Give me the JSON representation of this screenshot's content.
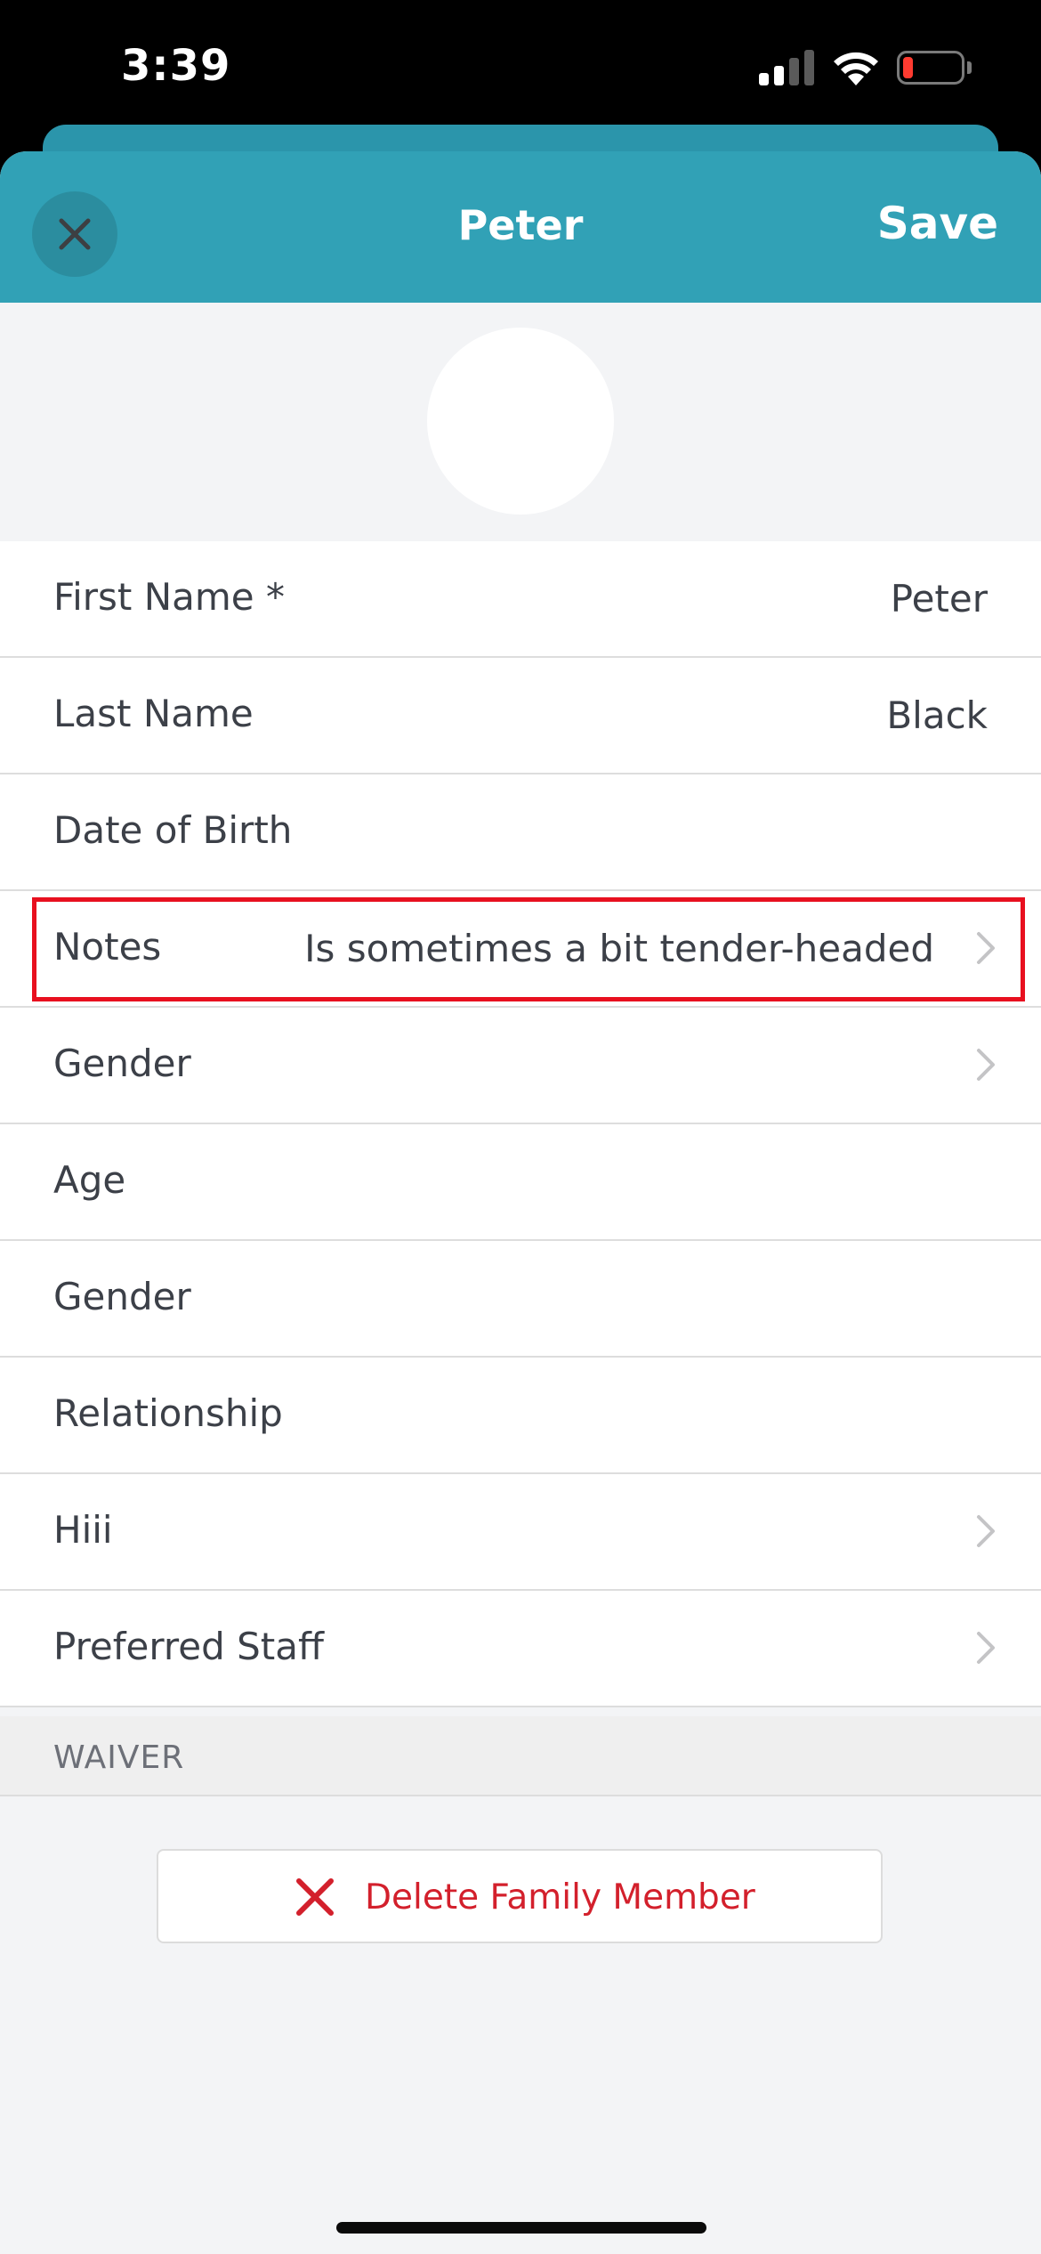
{
  "status_bar": {
    "time": "3:39",
    "icons": [
      "cellular-signal-icon",
      "wifi-icon",
      "battery-low-icon"
    ],
    "battery_level": 0.15,
    "battery_color": "#ff3b30"
  },
  "header": {
    "title": "Peter",
    "save_label": "Save",
    "close_icon": "close-icon",
    "background_color": "#31a1b6"
  },
  "form": {
    "rows": [
      {
        "label": "First Name *",
        "value": "Peter",
        "has_chevron": false
      },
      {
        "label": "Last Name",
        "value": "Black",
        "has_chevron": false
      },
      {
        "label": "Date of Birth",
        "value": "",
        "has_chevron": false
      },
      {
        "label": "Notes",
        "value": "Is sometimes a bit tender-headed",
        "has_chevron": true,
        "highlighted": true
      },
      {
        "label": "Gender",
        "value": "",
        "has_chevron": true
      },
      {
        "label": "Age",
        "value": "",
        "has_chevron": false
      },
      {
        "label": "Gender",
        "value": "",
        "has_chevron": false
      },
      {
        "label": "Relationship",
        "value": "",
        "has_chevron": false
      },
      {
        "label": "Hiii",
        "value": "",
        "has_chevron": true
      },
      {
        "label": "Preferred Staff",
        "value": "",
        "has_chevron": true
      }
    ]
  },
  "waiver_section": {
    "label": "WAIVER"
  },
  "delete_button": {
    "label": "Delete Family Member",
    "icon": "close-x-icon",
    "color": "#d3202c"
  },
  "highlight_color": "#e8101f"
}
